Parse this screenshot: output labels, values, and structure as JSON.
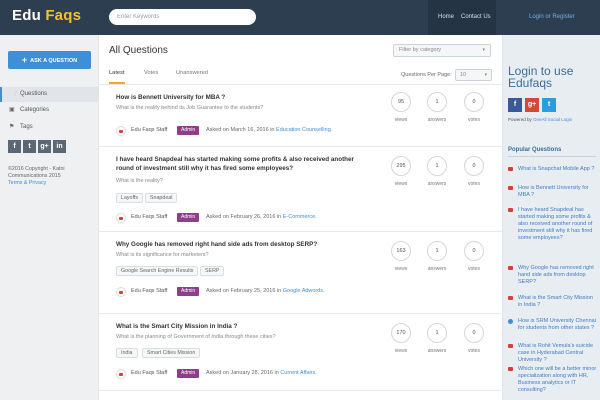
{
  "header": {
    "logo_main": "Edu",
    "logo_accent": "Faqs",
    "search_placeholder": "Enter Keywords",
    "nav_home": "Home",
    "nav_contact": "Contact Us",
    "login": "Login or Register"
  },
  "sidebar": {
    "ask_label": "ASK A QUESTION",
    "items": [
      {
        "label": "Questions",
        "icon": "question-icon"
      },
      {
        "label": "Categories",
        "icon": "folder-icon"
      },
      {
        "label": "Tags",
        "icon": "tag-icon"
      }
    ],
    "socials": [
      "f",
      "t",
      "g+",
      "in"
    ],
    "copyright": "©2016 Copyright - Katni Communications 2015",
    "terms": "Terms & Privacy"
  },
  "main": {
    "title": "All Questions",
    "filter_placeholder": "Filter by category",
    "tabs": [
      "Latest",
      "Votes",
      "Unanswered"
    ],
    "per_page_label": "Questions Per Page:",
    "per_page_value": "10",
    "stat_labels": {
      "views": "views",
      "answers": "answers",
      "votes": "votes"
    },
    "questions": [
      {
        "title": "How is Bennett University for MBA ?",
        "subtitle": "What is the reality behind its Job Guarantee to the students?",
        "tags": [],
        "author": "Edu Faqs Staff",
        "role": "Admin",
        "asked": "Asked on March 16, 2016 in",
        "category": "Education Counselling.",
        "views": "95",
        "answers": "1",
        "votes": "0"
      },
      {
        "title": "I have heard Snapdeal has started making some profits & also received another round of investment still why it has fired some employees?",
        "subtitle": "What is the reality?",
        "tags": [
          "Layoffs",
          "Snapdeal"
        ],
        "author": "Edu Faqs Staff",
        "role": "Admin",
        "asked": "Asked on February 26, 2016 in",
        "category": "E-Commerce.",
        "views": "295",
        "answers": "1",
        "votes": "0"
      },
      {
        "title": "Why Google has removed right hand side ads from desktop SERP?",
        "subtitle": "What is its significance for marketers?",
        "tags": [
          "Google Search Engine Results",
          "SERP"
        ],
        "author": "Edu Faqs Staff",
        "role": "Admin",
        "asked": "Asked on February 25, 2016 in",
        "category": "Google Adwords.",
        "views": "163",
        "answers": "1",
        "votes": "0"
      },
      {
        "title": "What is the Smart City Mission in India ?",
        "subtitle": "What is the planning of Government of India through these cities?",
        "tags": [
          "India",
          "Smart Cities Mission"
        ],
        "author": "Edu Faqs Staff",
        "role": "Admin",
        "asked": "Asked on January 28, 2016 in",
        "category": "Current Affairs.",
        "views": "170",
        "answers": "1",
        "votes": "0"
      }
    ]
  },
  "right": {
    "login_title": "Login to use Edufaqs",
    "social_buttons": [
      "f",
      "g+",
      "t"
    ],
    "powered_prefix": "Powered by",
    "powered_link": "OneAll Social Login",
    "popular_heading": "Popular Questions",
    "popular": [
      "What is Snapchat Mobile App ?",
      "How is Bennett University for MBA ?",
      "I have heard Snapdeal has started making some profits & also received another round of investment still why it has fired some employees?",
      "Why Google has removed right hand side ads from desktop SERP?",
      "What is the Smart City Mission in India ?",
      "How is SRM University Chennai for students from other states ?",
      "What is Rohit Vemula's suicide case in Hyderabad Central University ?",
      "Which one will be a better minor specialization along with HR, Business analytics or IT consulting?"
    ]
  }
}
